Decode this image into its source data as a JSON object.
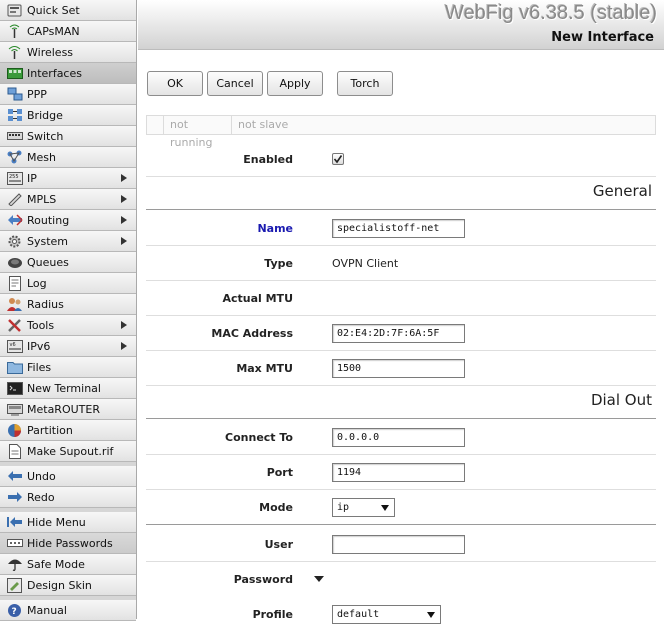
{
  "app": {
    "title": "WebFig v6.38.5 (stable)",
    "page_title": "New Interface"
  },
  "sidebar": {
    "items": [
      {
        "label": "Quick Set",
        "icon": "quick-set-icon",
        "submenu": false
      },
      {
        "label": "CAPsMAN",
        "icon": "capsman-icon",
        "submenu": false
      },
      {
        "label": "Wireless",
        "icon": "wireless-icon",
        "submenu": false
      },
      {
        "label": "Interfaces",
        "icon": "interfaces-icon",
        "submenu": false,
        "active": true
      },
      {
        "label": "PPP",
        "icon": "ppp-icon",
        "submenu": false
      },
      {
        "label": "Bridge",
        "icon": "bridge-icon",
        "submenu": false
      },
      {
        "label": "Switch",
        "icon": "switch-icon",
        "submenu": false
      },
      {
        "label": "Mesh",
        "icon": "mesh-icon",
        "submenu": false
      },
      {
        "label": "IP",
        "icon": "ip-icon",
        "submenu": true
      },
      {
        "label": "MPLS",
        "icon": "mpls-icon",
        "submenu": true
      },
      {
        "label": "Routing",
        "icon": "routing-icon",
        "submenu": true
      },
      {
        "label": "System",
        "icon": "system-gear-icon",
        "submenu": true
      },
      {
        "label": "Queues",
        "icon": "queues-icon",
        "submenu": false
      },
      {
        "label": "Log",
        "icon": "log-icon",
        "submenu": false
      },
      {
        "label": "Radius",
        "icon": "radius-icon",
        "submenu": false
      },
      {
        "label": "Tools",
        "icon": "tools-icon",
        "submenu": true
      },
      {
        "label": "IPv6",
        "icon": "ipv6-icon",
        "submenu": true
      },
      {
        "label": "Files",
        "icon": "files-icon",
        "submenu": false
      },
      {
        "label": "New Terminal",
        "icon": "terminal-icon",
        "submenu": false
      },
      {
        "label": "MetaROUTER",
        "icon": "metarouter-icon",
        "submenu": false
      },
      {
        "label": "Partition",
        "icon": "partition-icon",
        "submenu": false
      },
      {
        "label": "Make Supout.rif",
        "icon": "supout-icon",
        "submenu": false
      }
    ],
    "actions": [
      {
        "label": "Undo",
        "icon": "undo-icon"
      },
      {
        "label": "Redo",
        "icon": "redo-icon"
      }
    ],
    "options": [
      {
        "label": "Hide Menu",
        "icon": "hide-menu-icon"
      },
      {
        "label": "Hide Passwords",
        "icon": "hide-passwords-icon"
      },
      {
        "label": "Safe Mode",
        "icon": "safe-mode-icon"
      },
      {
        "label": "Design Skin",
        "icon": "design-skin-icon"
      }
    ],
    "help": {
      "label": "Manual",
      "icon": "manual-icon"
    }
  },
  "toolbar": {
    "ok": "OK",
    "cancel": "Cancel",
    "apply": "Apply",
    "torch": "Torch"
  },
  "status": {
    "running": "not running",
    "slave": "not slave"
  },
  "form": {
    "enabled_label": "Enabled",
    "enabled": true,
    "general_title": "General",
    "name_label": "Name",
    "name_value": "specialistoff-net",
    "type_label": "Type",
    "type_value": "OVPN Client",
    "actual_mtu_label": "Actual MTU",
    "mac_label": "MAC Address",
    "mac_value": "02:E4:2D:7F:6A:5F",
    "max_mtu_label": "Max MTU",
    "max_mtu_value": "1500",
    "dial_out_title": "Dial Out",
    "connect_to_label": "Connect To",
    "connect_to_value": "0.0.0.0",
    "port_label": "Port",
    "port_value": "1194",
    "mode_label": "Mode",
    "mode_value": "ip",
    "user_label": "User",
    "user_value": "",
    "password_label": "Password",
    "profile_label": "Profile",
    "profile_value": "default"
  }
}
